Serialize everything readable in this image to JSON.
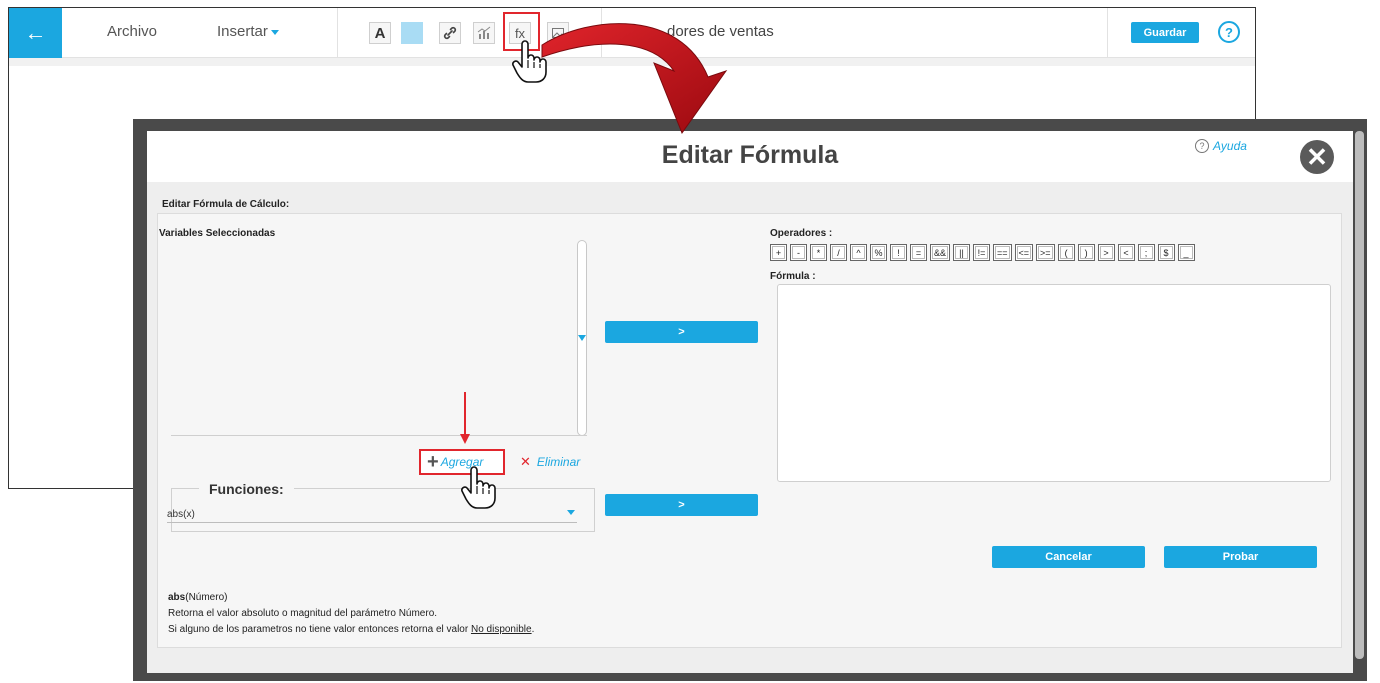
{
  "editor": {
    "back_icon": "arrow-left-icon",
    "menu_archivo": "Archivo",
    "menu_insertar": "Insertar",
    "doc_title_partial": "dores de ventas",
    "save_label": "Guardar",
    "help_icon": "question-circle-icon",
    "toolbar_icons": [
      "text-format-icon",
      "fill-color-icon",
      "link-icon",
      "chart-icon",
      "formula-icon",
      "image-icon"
    ],
    "text_icon_glyph": "A",
    "formula_icon_glyph": "fx"
  },
  "modal": {
    "title": "Editar Fórmula",
    "help_label": "Ayuda",
    "help_glyph": "?",
    "close_glyph": "✕",
    "section_label": "Editar Fórmula de Cálculo:",
    "variables_label": "Variables Seleccionadas",
    "arrow_button_label": ">",
    "add_label": "Agregar",
    "add_glyph": "+",
    "delete_label": "Eliminar",
    "delete_glyph": "✕",
    "functions_label": "Funciones:",
    "function_selected": "abs(x)",
    "operators_label": "Operadores :",
    "operators": [
      "+",
      "-",
      "*",
      "/",
      "^",
      "%",
      "!",
      "=",
      "&&",
      "||",
      "!=",
      "==",
      "<=",
      ">=",
      "(",
      ")",
      ">",
      "<",
      ";",
      "$",
      "_"
    ],
    "formula_label": "Fórmula :",
    "cancel_label": "Cancelar",
    "test_label": "Probar",
    "help": {
      "fn_name": "abs",
      "fn_args": "(Número)",
      "line1": "Retorna el valor absoluto o magnitud del parámetro Número.",
      "line2_prefix": "Si alguno de los parametros no tiene valor entonces retorna el valor ",
      "line2_link": "No disponible",
      "line2_suffix": "."
    }
  },
  "colors": {
    "accent": "#1ba7e0",
    "highlight_red": "#e1262d",
    "arrow_red": "#c8141c"
  }
}
